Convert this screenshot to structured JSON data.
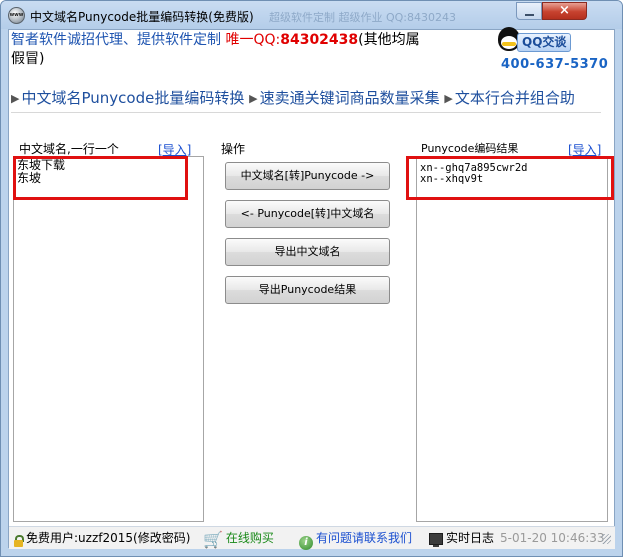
{
  "window": {
    "title": "中文域名Punycode批量编码转换(免费版)",
    "background_title_ghost": "超级软件定制 超级作业 QQ:8430243",
    "close_glyph": "×",
    "app_icon_text": "www"
  },
  "ad": {
    "text_blue": "智者软件诚招代理、提供软件定制 ",
    "text_red": "唯一QQ:",
    "qq_number": "84302438",
    "text_tail": "(其他均属假冒)",
    "qq_badge_label": "QQ交谈",
    "phone": "400-637-5370"
  },
  "nav": {
    "items": [
      {
        "label": "中文域名Punycode批量编码转换"
      },
      {
        "label": "速卖通关键词商品数量采集"
      },
      {
        "label": "文本行合并组合助"
      }
    ]
  },
  "left_panel": {
    "header": "中文域名,一行一个",
    "import_label": "[导入]",
    "content": "东坡下载\n东坡"
  },
  "ops_panel": {
    "header": "操作",
    "buttons": {
      "to_punycode": "中文域名[转]Punycode ->",
      "to_chinese": "<- Punycode[转]中文域名",
      "export_chinese": "导出中文域名",
      "export_punycode": "导出Punycode结果"
    }
  },
  "right_panel": {
    "header": "Punycode编码结果",
    "import_label": "[导入]",
    "content": "xn--ghq7a895cwr2d\nxn--xhqv9t"
  },
  "status": {
    "user": "免费用户:uzzf2015(修改密码)",
    "buy": "在线购买",
    "contact": "有问题请联系我们",
    "log_label": "实时日志",
    "timestamp": "5-01-20 10:46:33"
  },
  "colors": {
    "accent_blue": "#1e54b0",
    "highlight_red": "#e01010",
    "link_blue": "#1a4fd0",
    "link_green": "#1a8a1a"
  }
}
